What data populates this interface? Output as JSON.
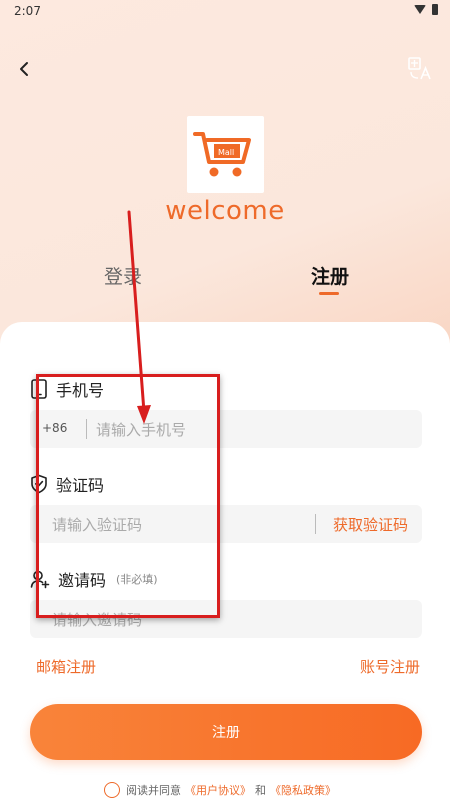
{
  "status_bar": {
    "time": "2:07"
  },
  "header": {
    "back_icon": "chevron-left-icon",
    "translate_icon": "translate-icon"
  },
  "brand": {
    "welcome_text": "welcome",
    "logo_text": "Mall",
    "accent_color": "#ee6a2a"
  },
  "tabs": [
    {
      "label": "登录",
      "active": false
    },
    {
      "label": "注册",
      "active": true
    }
  ],
  "form": {
    "phone": {
      "label": "手机号",
      "country_code": "+86",
      "placeholder": "请输入手机号"
    },
    "code": {
      "label": "验证码",
      "placeholder": "请输入验证码",
      "get_code_label": "获取验证码"
    },
    "invite": {
      "label": "邀请码",
      "hint": "(非必填)",
      "placeholder": "请输入邀请码"
    }
  },
  "links": {
    "email_register": "邮箱注册",
    "account_register": "账号注册"
  },
  "submit_label": "注册",
  "agreement": {
    "prefix": "阅读并同意",
    "user_agreement": "《用户协议》",
    "and": "和",
    "privacy_policy": "《隐私政策》"
  }
}
